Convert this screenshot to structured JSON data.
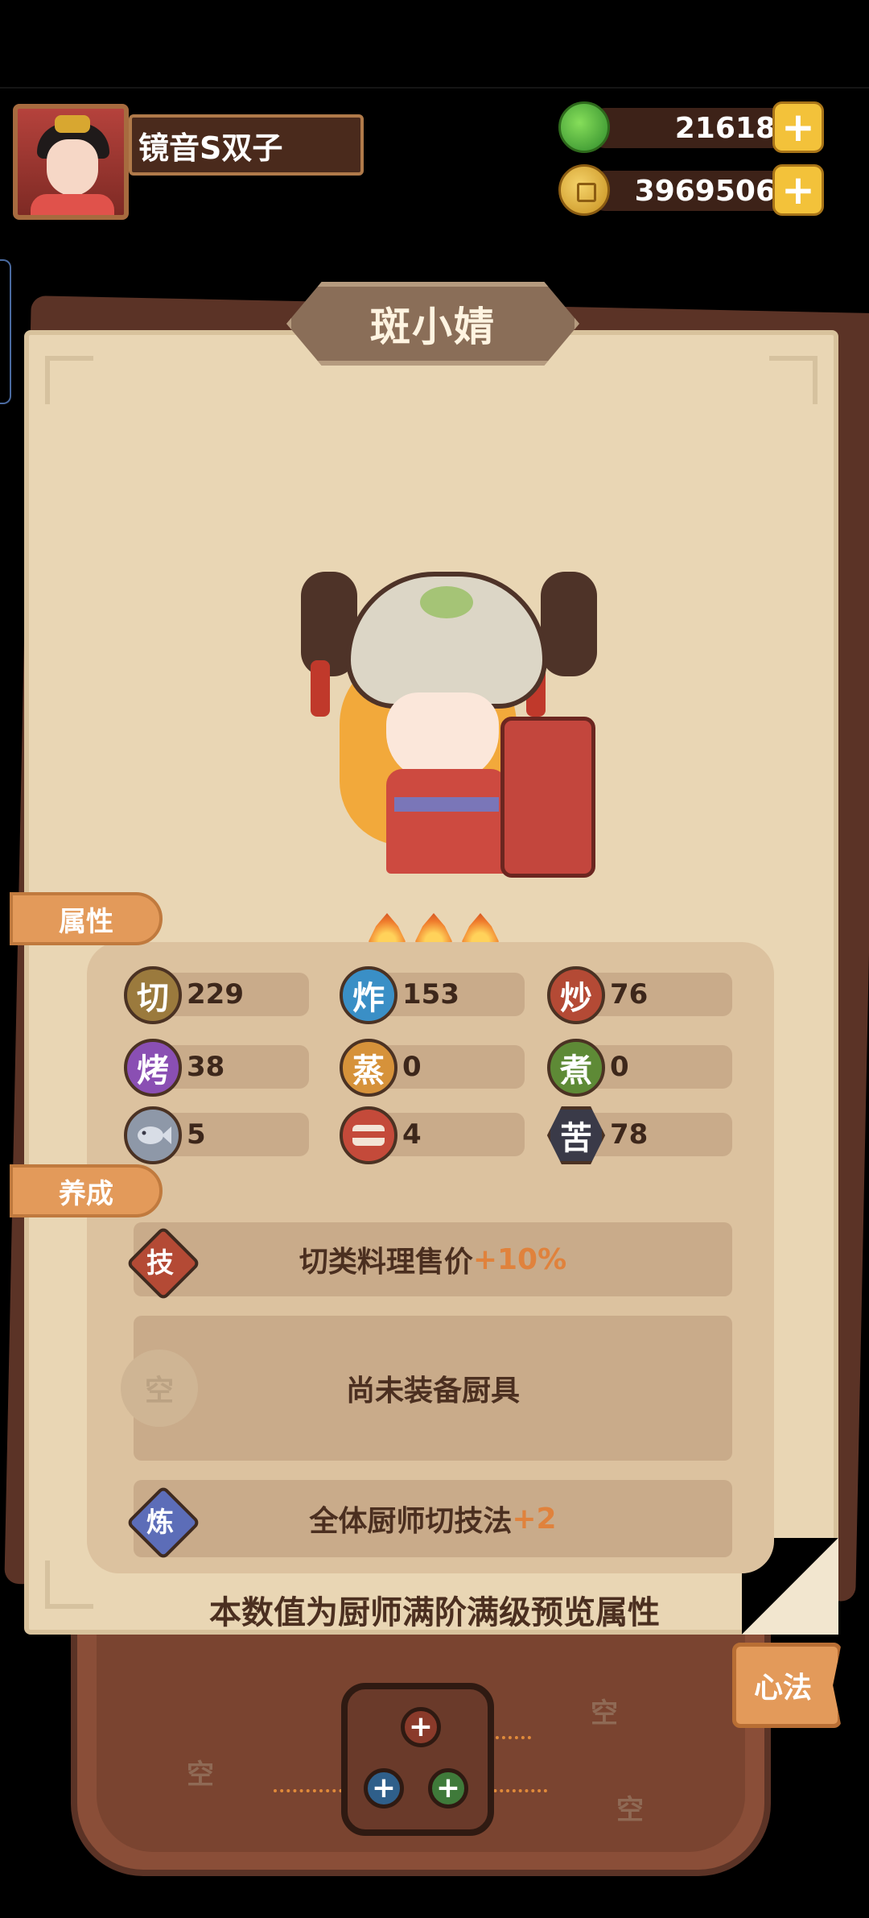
{
  "player": {
    "name": "镜音S双子"
  },
  "currency": [
    {
      "icon": "jade-icon",
      "value": "21618"
    },
    {
      "icon": "coin-icon",
      "value": "3969506"
    }
  ],
  "chef": {
    "name": "斑小婧",
    "stars": 3
  },
  "tabs": {
    "attributes": "属性",
    "cultivation": "养成"
  },
  "stats": [
    {
      "icon": "cut",
      "label": "切",
      "value": "229",
      "color": "#9b7a3d"
    },
    {
      "icon": "fry",
      "label": "炸",
      "value": "153",
      "color": "#3a8fc6"
    },
    {
      "icon": "stirfry",
      "label": "炒",
      "value": "76",
      "color": "#b44a35"
    },
    {
      "icon": "roast",
      "label": "烤",
      "value": "38",
      "color": "#8a4fb3"
    },
    {
      "icon": "steam",
      "label": "蒸",
      "value": "0",
      "color": "#d6923a"
    },
    {
      "icon": "boil",
      "label": "煮",
      "value": "0",
      "color": "#5e8a36"
    },
    {
      "icon": "fish",
      "label": "",
      "value": "5",
      "color": "#8e98a8"
    },
    {
      "icon": "meat",
      "label": "",
      "value": "4",
      "color": "#c44a3a"
    },
    {
      "icon": "bitter",
      "label": "苦",
      "value": "78",
      "color": "#3a3a48"
    }
  ],
  "skill": {
    "badge": "技",
    "text": "切类料理售价",
    "bonus": "+10%"
  },
  "equipment": {
    "badge": "空",
    "text": "尚未装备厨具"
  },
  "refine": {
    "badge": "炼",
    "text": "全体厨师切技法",
    "bonus": "+2"
  },
  "preview_note": "本数值为厨师满阶满级预览属性",
  "mind": {
    "button": "心法",
    "slot_plus": "+",
    "empty_label": "空"
  }
}
